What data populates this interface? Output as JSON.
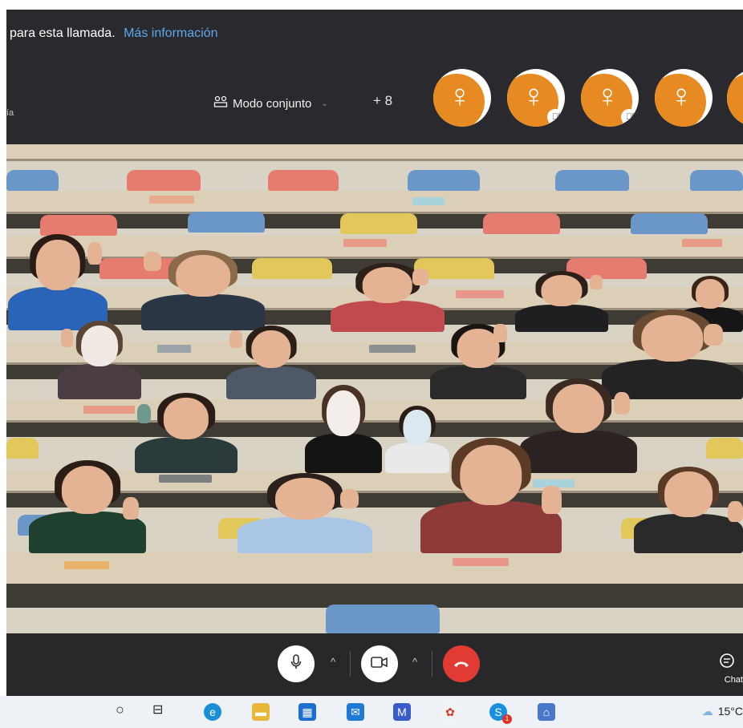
{
  "notice": {
    "text": "para esta llamada.",
    "link": "Más información"
  },
  "header": {
    "side_label": "ía",
    "mode_label": "Modo conjunto",
    "mode_icon": "group-icon",
    "more_participants": "+ 8",
    "avatars": [
      {
        "symbol": "♀",
        "muted": false
      },
      {
        "symbol": "♀",
        "muted": true
      },
      {
        "symbol": "♀",
        "muted": true
      },
      {
        "symbol": "♀",
        "muted": false
      },
      {
        "symbol": "♀",
        "muted": false
      }
    ],
    "accent_color": "#e88a22"
  },
  "controls": {
    "mic_icon": "microphone-icon",
    "camera_icon": "camera-icon",
    "hangup_icon": "hang-up-icon",
    "hangup_color": "#e23b33",
    "chat_label": "Chat"
  },
  "taskbar": {
    "icons": [
      "search-circle-icon",
      "task-view-icon",
      "edge-icon",
      "file-explorer-icon",
      "store-icon",
      "mail-icon",
      "visual-studio-icon",
      "paint-icon",
      "skype-icon",
      "network-app-icon"
    ],
    "skype_badge": "1",
    "weather": "15°C"
  }
}
